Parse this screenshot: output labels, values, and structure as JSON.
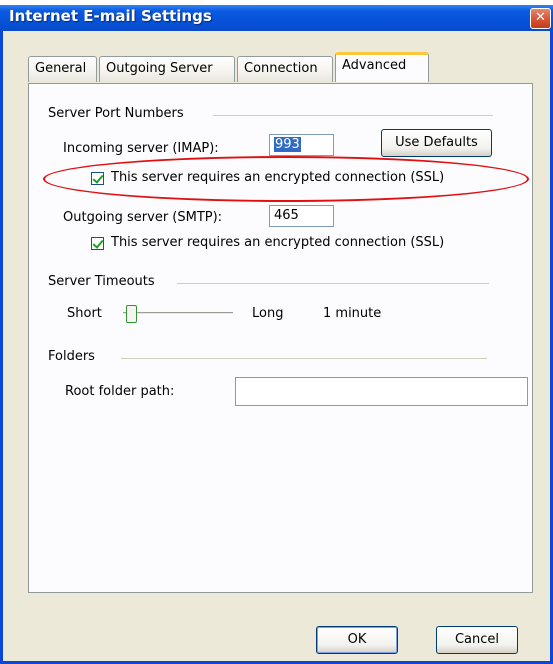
{
  "window": {
    "title": "Internet E-mail Settings",
    "close_glyph": "✕"
  },
  "tabs": [
    {
      "label": "General"
    },
    {
      "label": "Outgoing Server"
    },
    {
      "label": "Connection"
    },
    {
      "label": "Advanced",
      "active": true
    }
  ],
  "ports": {
    "group_label": "Server Port Numbers",
    "incoming_label": "Incoming server (IMAP):",
    "incoming_value": "993",
    "use_defaults_label": "Use Defaults",
    "incoming_ssl_label": "This server requires an encrypted connection (SSL)",
    "incoming_ssl_checked": true,
    "outgoing_label": "Outgoing server (SMTP):",
    "outgoing_value": "465",
    "outgoing_ssl_label": "This server requires an encrypted connection (SSL)",
    "outgoing_ssl_checked": true
  },
  "timeouts": {
    "group_label": "Server Timeouts",
    "short_label": "Short",
    "long_label": "Long",
    "value_text": "1 minute",
    "level": 0.0
  },
  "folders": {
    "group_label": "Folders",
    "root_label": "Root folder path:",
    "root_value": ""
  },
  "buttons": {
    "ok_label": "OK",
    "cancel_label": "Cancel"
  },
  "colors": {
    "titlebar": "#0552d8",
    "annotation": "#e01010",
    "check": "#21a121"
  },
  "icons": {
    "close": "close-icon",
    "check": "checkmark-icon"
  }
}
